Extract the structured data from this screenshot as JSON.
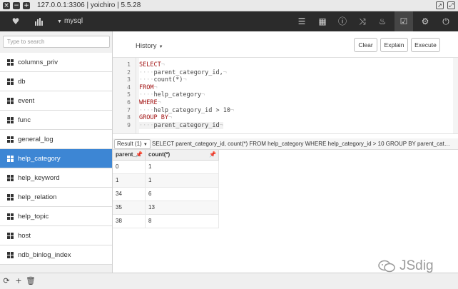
{
  "window": {
    "title": "127.0.0.1:3306 | yoichiro | 5.5.28"
  },
  "toolbar": {
    "database": "mysql",
    "icons": [
      "heart-icon",
      "bar-chart-icon",
      "menu-icon",
      "table-icon",
      "info-icon",
      "shuffle-icon",
      "fire-icon",
      "query-icon",
      "settings-icon",
      "power-icon"
    ]
  },
  "sidebar": {
    "search_placeholder": "Type to search",
    "tables": [
      {
        "label": "columns_priv"
      },
      {
        "label": "db"
      },
      {
        "label": "event"
      },
      {
        "label": "func"
      },
      {
        "label": "general_log"
      },
      {
        "label": "help_category",
        "active": true
      },
      {
        "label": "help_keyword"
      },
      {
        "label": "help_relation"
      },
      {
        "label": "help_topic"
      },
      {
        "label": "host"
      },
      {
        "label": "ndb_binlog_index"
      }
    ]
  },
  "query": {
    "history_label": "History",
    "clear_label": "Clear",
    "explain_label": "Explain",
    "execute_label": "Execute",
    "lines": [
      {
        "n": "1",
        "text": "SELECT"
      },
      {
        "n": "2",
        "text": "parent_category_id,"
      },
      {
        "n": "3",
        "text": "count(*)"
      },
      {
        "n": "4",
        "text": "FROM"
      },
      {
        "n": "5",
        "text": "help_category"
      },
      {
        "n": "6",
        "text": "WHERE"
      },
      {
        "n": "7",
        "text": "help_category_id > 10"
      },
      {
        "n": "8",
        "text": "GROUP BY"
      },
      {
        "n": "9",
        "text": "parent_category_id"
      }
    ]
  },
  "result": {
    "selector": "Result (1)",
    "sql": "SELECT parent_category_id, count(*) FROM help_category WHERE help_category_id > 10 GROUP BY parent_category_id",
    "columns": [
      "parent_...",
      "count(*)"
    ],
    "rows": [
      [
        "0",
        "1"
      ],
      [
        "1",
        "1"
      ],
      [
        "34",
        "6"
      ],
      [
        "35",
        "13"
      ],
      [
        "38",
        "8"
      ]
    ]
  },
  "watermark": {
    "text": "JSdig"
  }
}
